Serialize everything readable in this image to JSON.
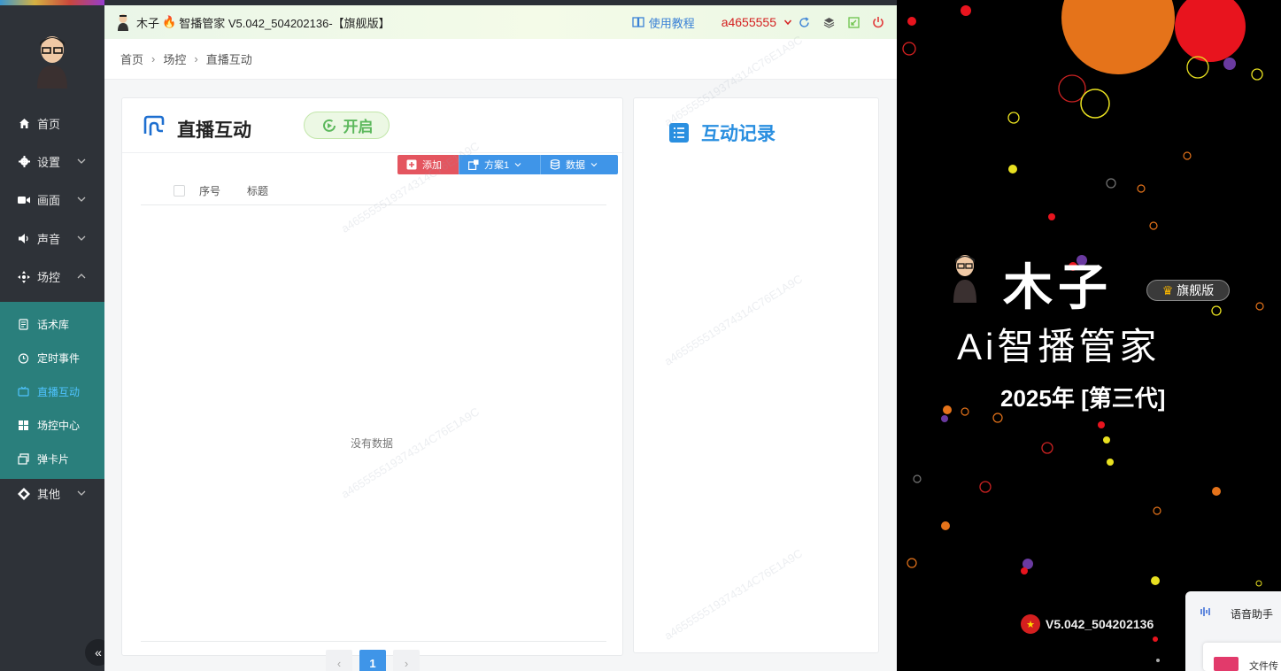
{
  "titlebar": {
    "app_name": "木子",
    "app_title_rest": "智播管家 V5.042_504202136-【旗舰版】",
    "tutorial": "使用教程",
    "user": "a4655555"
  },
  "sidebar": {
    "items": [
      {
        "label": "首页"
      },
      {
        "label": "设置"
      },
      {
        "label": "画面"
      },
      {
        "label": "声音"
      },
      {
        "label": "场控"
      },
      {
        "label": "其他"
      }
    ],
    "sub_items": [
      {
        "label": "话术库"
      },
      {
        "label": "定时事件"
      },
      {
        "label": "直播互动"
      },
      {
        "label": "场控中心"
      },
      {
        "label": "弹卡片"
      }
    ],
    "collapse": "«"
  },
  "breadcrumb": [
    "首页",
    "场控",
    "直播互动"
  ],
  "panel_left": {
    "title": "直播互动",
    "start_button": "开启",
    "toolbar": {
      "add": "添加",
      "scheme": "方案1",
      "data": "数据"
    },
    "columns": [
      "序号",
      "标题"
    ],
    "empty_text": "没有数据",
    "pager": {
      "prev": "‹",
      "current": "1",
      "next": "›"
    }
  },
  "panel_right": {
    "title": "互动记录"
  },
  "watermark": "a465555519374314C76E1A9C",
  "preview": {
    "brand": "木子",
    "badge": "旗舰版",
    "title": "Ai智播管家",
    "subtitle": "2025年 [第三代]",
    "version": "V5.042_504202136",
    "voice_assistant": "语音助手",
    "voice_line2": "…",
    "file_label": "文件传"
  },
  "colors": {
    "sidebar_bg": "#2e3238",
    "submenu_bg": "#2a7f7c",
    "active_sub": "#4fc3ff",
    "primary": "#3f95e8",
    "danger": "#e4555f",
    "success": "#5cb85c",
    "user_red": "#d41f1f"
  }
}
